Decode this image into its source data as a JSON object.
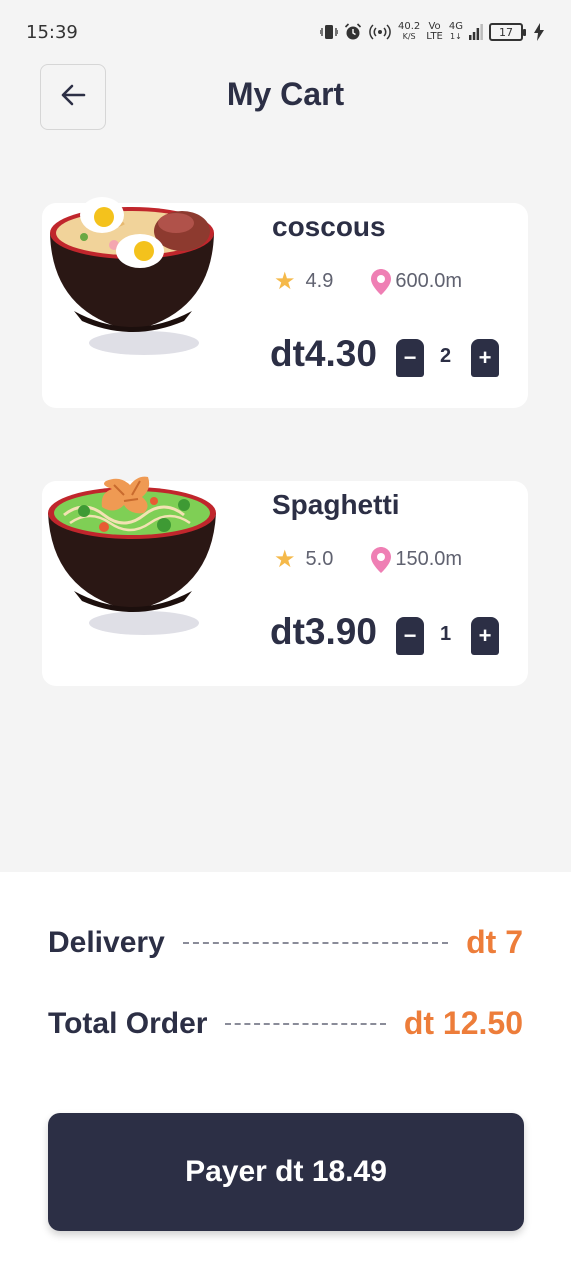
{
  "status_bar": {
    "time": "15:39",
    "net_speed_value": "40.2",
    "net_speed_unit": "K/S",
    "network_1_top": "Vo",
    "network_1_bottom": "LTE",
    "network_2_top": "4G",
    "network_2_bottom": "1↓",
    "battery": "17"
  },
  "header": {
    "title": "My Cart",
    "back_icon": "arrow-left-icon"
  },
  "cart_items": [
    {
      "name": "coscous",
      "rating": "4.9",
      "distance": "600.0m",
      "price": "dt4.30",
      "quantity": "2",
      "image": "egg-ramen-bowl"
    },
    {
      "name": "Spaghetti",
      "rating": "5.0",
      "distance": "150.0m",
      "price": "dt3.90",
      "quantity": "1",
      "image": "shrimp-noodle-bowl"
    }
  ],
  "summary": {
    "delivery_label": "Delivery",
    "delivery_value": "dt 7",
    "total_label": "Total Order",
    "total_value": "dt 12.50",
    "pay_button": "Payer dt 18.49"
  },
  "colors": {
    "primary": "#2c2f45",
    "accent": "#ed7d3a",
    "star": "#f5b94a",
    "pin": "#ef7fb4",
    "background": "#f4f4f4"
  }
}
